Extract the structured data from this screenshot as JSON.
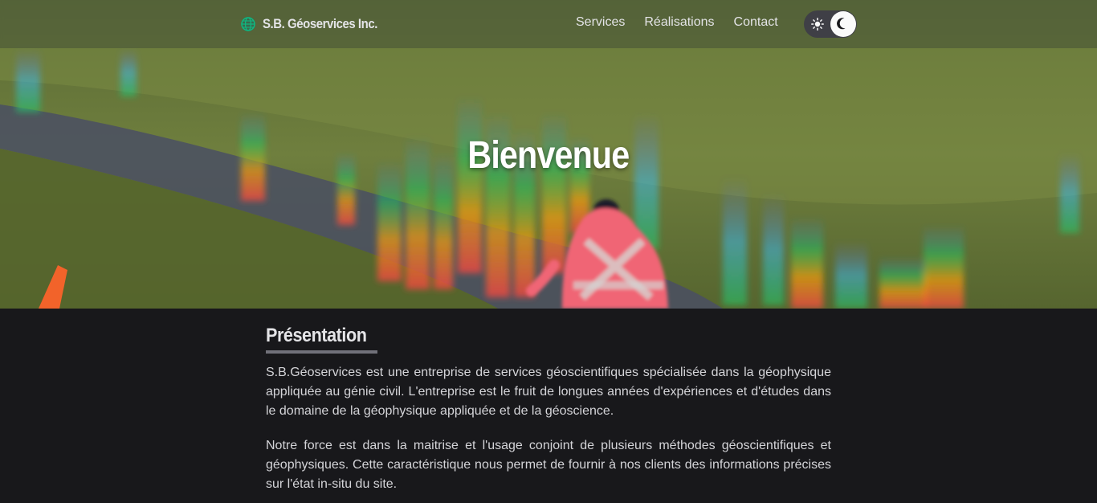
{
  "brand": {
    "name": "S.B. Géoservices Inc.",
    "logo_icon": "globe-logo-icon",
    "logo_color": "#10b981"
  },
  "nav": {
    "items": [
      {
        "label": "Services"
      },
      {
        "label": "Réalisations"
      },
      {
        "label": "Contact"
      }
    ]
  },
  "theme_toggle": {
    "left_icon": "sun-icon",
    "right_icon": "moon-icon",
    "state": "dark"
  },
  "hero": {
    "title": "Bienvenue"
  },
  "presentation": {
    "title": "Présentation",
    "paragraphs": [
      "S.B.Géoservices est une entreprise de services géoscientifiques spécialisée dans la géophysique appliquée au génie civil. L'entreprise est le fruit de longues années d'expériences et d'études dans le domaine de la géophysique appliquée et de la géoscience.",
      "Notre force est dans la maitrise et l'usage conjoint de plusieurs méthodes géoscientifiques et géophysiques. Cette caractéristique nous permet de fournir à nos clients des informations précises sur l'état in-situ du site."
    ]
  },
  "colors": {
    "page_background": "#18181b",
    "text": "#d4d4d8",
    "heading_underline": "#71717a"
  }
}
